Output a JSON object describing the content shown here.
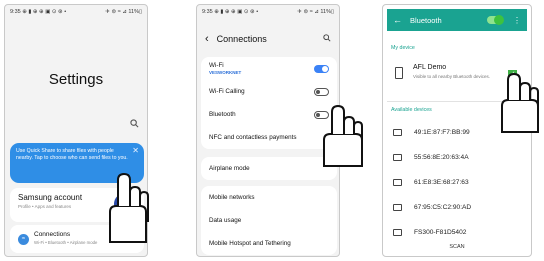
{
  "phone1": {
    "status_time": "9:35 ⊕ ▮ ⊕ ⊕ ▣ ⊙ ⊛ •",
    "status_right": "✈ ⊜ ≈ ⊿ 11%▯",
    "title": "Settings",
    "search_icon": "search-icon",
    "quick_share_text": "Use Quick Share to share files with people nearby. Tap to choose who can send files to you.",
    "quick_share_close": "✕",
    "account_title": "Samsung account",
    "account_sub": "Profile • Apps and features",
    "connections_title": "Connections",
    "connections_sub": "Wi-Fi • Bluetooth • Airplane mode"
  },
  "phone2": {
    "status_time": "9:35 ⊕ ▮ ⊕ ⊕ ▣ ⊙ ⊛ •",
    "status_right": "✈ ⊜ ≈ ⊿ 11%▯",
    "title": "Connections",
    "rows_group1": [
      {
        "label": "Wi-Fi",
        "sub": "VESWORKNET",
        "toggle": "on"
      },
      {
        "label": "Wi-Fi Calling",
        "sub": "",
        "toggle": "off"
      },
      {
        "label": "Bluetooth",
        "sub": "",
        "toggle": "off"
      },
      {
        "label": "NFC and contactless payments",
        "sub": "",
        "toggle": "none"
      }
    ],
    "airplane": "Airplane mode",
    "rows_group3": [
      "Mobile networks",
      "Data usage",
      "Mobile Hotspot and Tethering"
    ]
  },
  "phone3": {
    "title": "Bluetooth",
    "section_my_device": "My device",
    "my_device_name": "AFL Demo",
    "my_device_desc": "Visible to all nearby Bluetooth devices.",
    "section_available": "Available devices",
    "devices": [
      "49:1E:87:F7:BB:99",
      "55:56:8E:20:63:4A",
      "61:E8:3E:68:27:63",
      "67:95:C5:C2:90:AD",
      "FS300-F81D5402"
    ],
    "scan_label": "SCAN"
  },
  "colors": {
    "accent_blue": "#2f8ee6",
    "bt_appbar": "#1aa391",
    "check_green": "#3eb045"
  }
}
